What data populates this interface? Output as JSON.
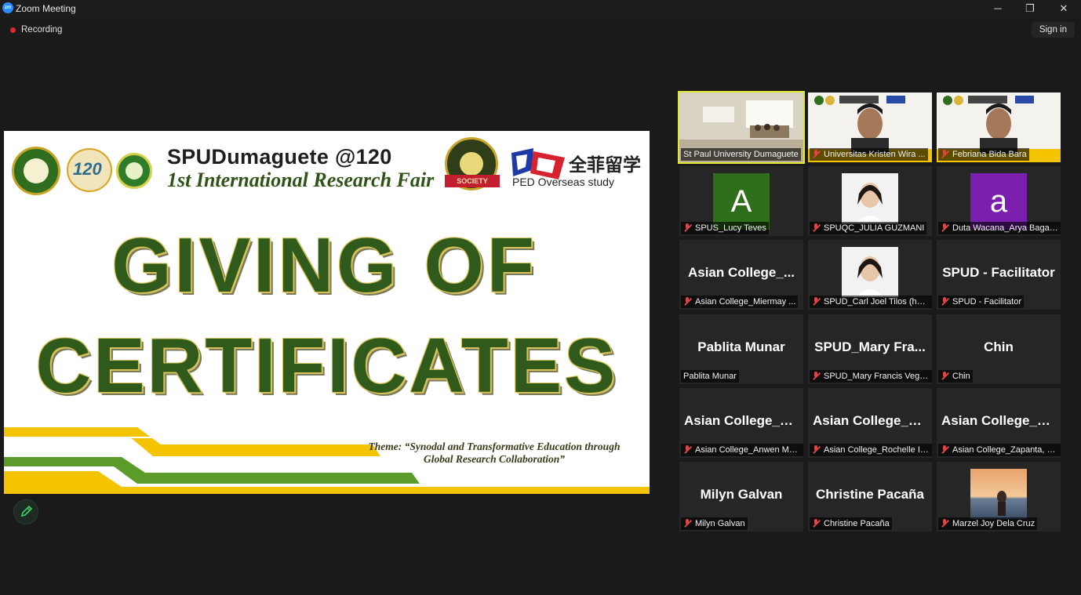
{
  "window": {
    "app_icon_text": "zm",
    "title": "Zoom Meeting",
    "minimize_glyph": "─",
    "restore_glyph": "❐",
    "close_glyph": "✕"
  },
  "toolbar": {
    "recording_label": "Recording",
    "signin_label": "Sign in"
  },
  "slide": {
    "heading": "SPUDumaguete @120",
    "subheading": "1st International Research Fair",
    "badge_text": "SOCIETY",
    "logo2_text": "120",
    "sponsor_cn": "全菲留学",
    "sponsor_en": "PED Overseas study",
    "line1": "GIVING OF",
    "line2": "CERTIFICATES",
    "theme_line1": "Theme: “Synodal and Transformative Education through",
    "theme_line2": "Global Research Collaboration”"
  },
  "participants": [
    {
      "label": "St Paul University Dumaguete",
      "display": "",
      "kind": "video-room",
      "muted": false,
      "active": true
    },
    {
      "label": "Universitas Kristen Wira ...",
      "display": "",
      "kind": "video-banner",
      "muted": true
    },
    {
      "label": "Febriana Bida Bara",
      "display": "",
      "kind": "video-banner",
      "muted": true
    },
    {
      "label": "SPUS_Lucy Teves",
      "display": "A",
      "kind": "letter",
      "muted": true,
      "color": "#2f6e1a"
    },
    {
      "label": "SPUQC_JULIA GUZMANI",
      "display": "",
      "kind": "photo",
      "muted": true
    },
    {
      "label": "Duta Wacana_Arya Bagas...",
      "display": "a",
      "kind": "letter",
      "muted": true,
      "color": "#7a1fae"
    },
    {
      "label": "Asian College_Miermay ...",
      "display": "Asian  College_...",
      "kind": "name",
      "muted": true
    },
    {
      "label": "SPUD_Carl Joel Tilos (he/...",
      "display": "",
      "kind": "photo",
      "muted": true
    },
    {
      "label": "SPUD - Facilitator",
      "display": "SPUD - Facilitator",
      "kind": "name",
      "muted": true
    },
    {
      "label": "Pablita Munar",
      "display": "Pablita Munar",
      "kind": "name",
      "muted": false
    },
    {
      "label": "SPUD_Mary Francis Vega ...",
      "display": "SPUD_Mary Fra...",
      "kind": "name",
      "muted": true
    },
    {
      "label": "Chin",
      "display": "Chin",
      "kind": "name",
      "muted": true
    },
    {
      "label": "Asian College_Anwen Mu...",
      "display": "Asian  College_A...",
      "kind": "name",
      "muted": true
    },
    {
      "label": "Asian College_Rochelle Ib...",
      "display": "Asian  College_R...",
      "kind": "name",
      "muted": true
    },
    {
      "label": "Asian College_Zapanta, Jo...",
      "display": "Asian  College_Z...",
      "kind": "name",
      "muted": true
    },
    {
      "label": "Milyn Galvan",
      "display": "Milyn Galvan",
      "kind": "name",
      "muted": true
    },
    {
      "label": "Christine Pacaña",
      "display": "Christine Pacaña",
      "kind": "name",
      "muted": true
    },
    {
      "label": "Marzel Joy Dela Cruz",
      "display": "",
      "kind": "photo-sunset",
      "muted": true
    }
  ],
  "colors": {
    "active_speaker_border": "#e2e836",
    "recording_dot": "#e02828",
    "slide_green": "#2f5a1c",
    "slide_gold": "#f5c400"
  },
  "icons": {
    "annotate": "pencil-icon",
    "mic_muted": "mic-muted-icon"
  }
}
